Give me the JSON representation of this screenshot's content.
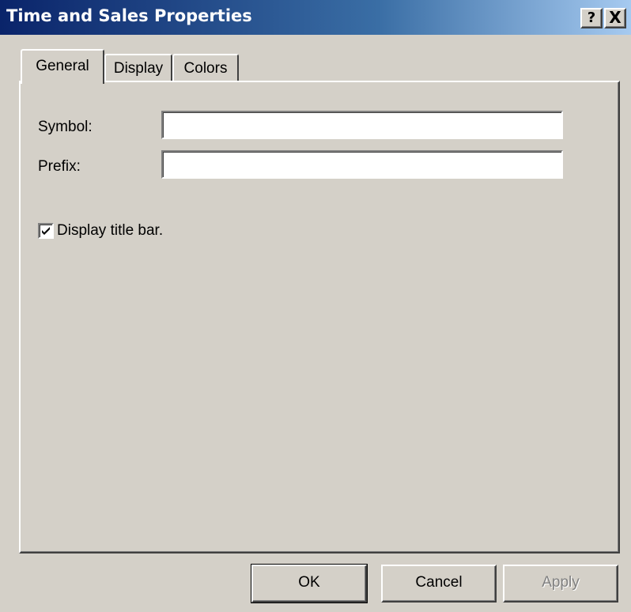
{
  "window": {
    "title": "Time and Sales Properties",
    "help_label": "?",
    "close_label": "X",
    "titlebar_color": "#0a246a",
    "face_color": "#d4d0c8"
  },
  "tabs": [
    {
      "label": "General",
      "selected": true
    },
    {
      "label": "Display",
      "selected": false
    },
    {
      "label": "Colors",
      "selected": false
    }
  ],
  "general": {
    "symbol_label": "Symbol:",
    "symbol_value": "",
    "prefix_label": "Prefix:",
    "prefix_value": "",
    "display_title_bar_label": "Display title bar.",
    "display_title_bar_checked": true
  },
  "buttons": {
    "ok": "OK",
    "cancel": "Cancel",
    "apply": "Apply",
    "apply_enabled": false
  }
}
